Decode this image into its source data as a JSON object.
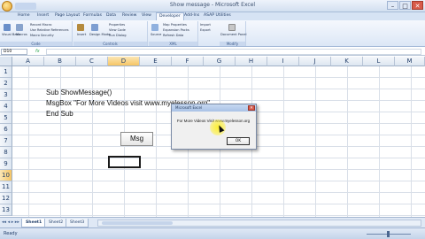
{
  "window": {
    "title": "Show message - Microsoft Excel",
    "controls": [
      "–",
      "□",
      "✕"
    ]
  },
  "tabs": [
    "Home",
    "Insert",
    "Page Layout",
    "Formulas",
    "Data",
    "Review",
    "View",
    "Developer",
    "Add-Ins",
    "ASAP Utilities"
  ],
  "active_tab": "Developer",
  "ribbon": {
    "groups": [
      {
        "label": "Code",
        "items": [
          "Visual Basic",
          "Macros",
          "Record Macro",
          "Use Relative References",
          "Macro Security"
        ]
      },
      {
        "label": "Controls",
        "items": [
          "Insert",
          "Design Mode",
          "Properties",
          "View Code",
          "Run Dialog"
        ]
      },
      {
        "label": "XML",
        "items": [
          "Source",
          "Map Properties",
          "Expansion Packs",
          "Refresh Data",
          "Import",
          "Export"
        ]
      },
      {
        "label": "Modify",
        "items": [
          "Document Panel"
        ]
      }
    ]
  },
  "formula_bar": {
    "name_box": "D10",
    "fx": "fx",
    "content": ""
  },
  "columns": [
    "A",
    "B",
    "C",
    "D",
    "E",
    "F",
    "G",
    "H",
    "I",
    "J",
    "K",
    "L",
    "M"
  ],
  "selected_column": "D",
  "rows": [
    "1",
    "2",
    "3",
    "4",
    "5",
    "6",
    "7",
    "8",
    "9",
    "10",
    "11",
    "12",
    "13"
  ],
  "selected_row": "10",
  "cells": {
    "b3": "Sub ShowMessage()",
    "b4": "MsgBox \"For More Videos visit www.myelesson.org\"",
    "b5": "End Sub"
  },
  "form_button": {
    "label": "Msg"
  },
  "msgbox": {
    "title": "Microsoft Excel",
    "text": "For More Videos Visit www.myelesson.org",
    "ok_label": "OK"
  },
  "sheets": [
    "Sheet1",
    "Sheet2",
    "Sheet3"
  ],
  "active_sheet": "Sheet1",
  "status": {
    "text": "Ready",
    "zoom": "100%"
  },
  "colors": {
    "ribbon": "#dce7f6",
    "selection_header": "#f6c564",
    "msgbox_title": "#a9c2e6",
    "highlight": "#fff028"
  }
}
